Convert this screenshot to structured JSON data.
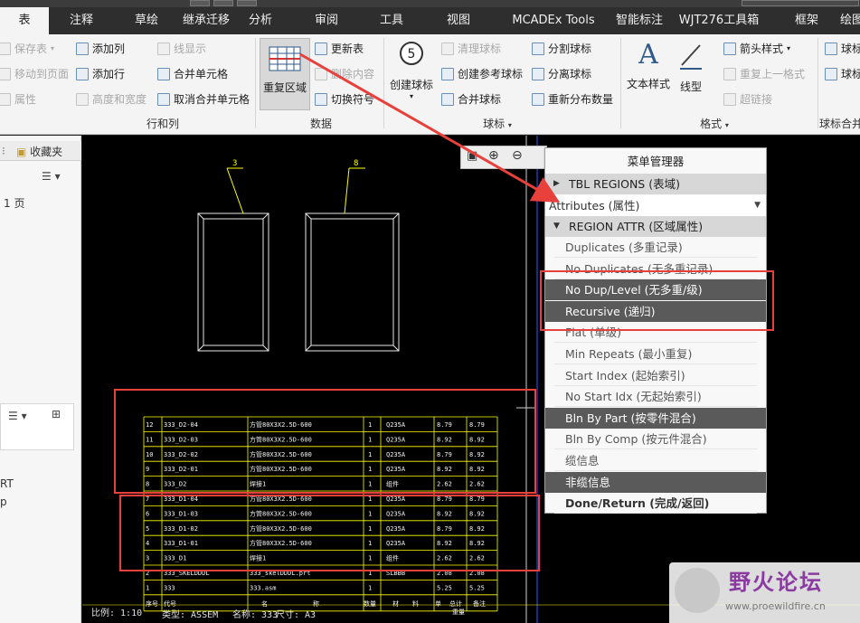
{
  "menu_tabs": [
    "表",
    "注释",
    "草绘",
    "继承迁移",
    "分析",
    "审阅",
    "工具",
    "视图",
    "MCADEx Tools",
    "智能标注",
    "WJT276工具箱",
    "框架",
    "绘图"
  ],
  "ribbon": {
    "col1": [
      "保存表",
      "移动到页面",
      "属性"
    ],
    "col2": [
      "添加列",
      "添加行",
      "高度和宽度"
    ],
    "col3": [
      "线显示",
      "合并单元格",
      "取消合并单元格"
    ],
    "group_rowcol": "行和列",
    "repeat_region": "重复区域",
    "col4": [
      "更新表",
      "删除内容",
      "切换符号"
    ],
    "group_data": "数据",
    "create_balloon": "创建球标",
    "col5": [
      "清理球标",
      "创建参考球标",
      "合并球标"
    ],
    "col6": [
      "分割球标",
      "分离球标",
      "重新分布数量"
    ],
    "group_balloon": "球标",
    "text_style": "文本样式",
    "line_type": "线型",
    "col7": [
      "箭头样式",
      "重复上一格式",
      "超链接"
    ],
    "group_format": "格式",
    "col8": [
      "球标",
      "球标"
    ],
    "group_balloon_merge": "球标合并"
  },
  "left_panel": {
    "favorites": "收藏夹",
    "page": "1 页",
    "rt": "RT",
    "p": "p"
  },
  "drawing": {
    "balloon_left": "3",
    "balloon_right": "8",
    "bom_rows": [
      [
        "12",
        "333_D2-04",
        "方管80X3X2.5D-600",
        "1",
        "Q235A",
        "8.79",
        "8.79"
      ],
      [
        "11",
        "333_D2-03",
        "方管80X3X2.5D-600",
        "1",
        "Q235A",
        "8.92",
        "8.92"
      ],
      [
        "10",
        "333_D2-02",
        "方管80X3X2.5D-600",
        "1",
        "Q235A",
        "8.79",
        "8.92"
      ],
      [
        "9",
        "333_D2-01",
        "方管80X3X2.5D-600",
        "1",
        "Q235A",
        "8.92",
        "8.92"
      ],
      [
        "8",
        "333_D2",
        "焊接1",
        "1",
        "组件",
        "2.62",
        "2.62"
      ],
      [
        "7",
        "333_D1-04",
        "方管80X3X2.5D-600",
        "1",
        "Q235A",
        "8.79",
        "8.79"
      ],
      [
        "6",
        "333_D1-03",
        "方管80X3X2.5D-600",
        "1",
        "Q235A",
        "8.92",
        "8.92"
      ],
      [
        "5",
        "333_D1-02",
        "方管80X3X2.5D-600",
        "1",
        "Q235A",
        "8.79",
        "8.92"
      ],
      [
        "4",
        "333_D1-01",
        "方管80X3X2.5D-600",
        "1",
        "Q235A",
        "8.92",
        "8.92"
      ],
      [
        "3",
        "333_D1",
        "焊接1",
        "1",
        "组件",
        "2.62",
        "2.62"
      ],
      [
        "2",
        "333_SKELDDDL",
        "333_skelDDDL.prt",
        "1",
        "SLBBB",
        "2.08",
        "2.08"
      ],
      [
        "1",
        "333",
        "333.asm",
        "1",
        "",
        "5.25",
        "5.25"
      ]
    ],
    "header_row": [
      "序号",
      "代号",
      "名",
      "称",
      "数量",
      "材",
      "料",
      "单",
      "总计",
      "备注"
    ],
    "weight_label": "重量",
    "footer_scale": "比例: 1:10",
    "footer_type": "类型: ASSEM",
    "footer_name": "名称: 333",
    "footer_size": "尺寸: A3"
  },
  "menu_manager": {
    "title": "菜单管理器",
    "head1": "TBL REGIONS (表域)",
    "select": "Attributes (属性)",
    "head2": "REGION ATTR (区域属性)",
    "items": [
      {
        "label": "Duplicates (多重记录)",
        "sel": false
      },
      {
        "label": "No Duplicates (无多重记录)",
        "sel": false
      },
      {
        "label": "No Dup/Level (无多重/级)",
        "sel": true
      },
      {
        "label": "Recursive (递归)",
        "sel": true
      },
      {
        "label": "Flat (单级)",
        "sel": false
      },
      {
        "label": "Min Repeats (最小重复)",
        "sel": false
      },
      {
        "label": "Start Index (起始索引)",
        "sel": false
      },
      {
        "label": "No Start Idx (无起始索引)",
        "sel": false
      },
      {
        "label": "Bln By Part (按零件混合)",
        "sel": true
      },
      {
        "label": "Bln By Comp (按元件混合)",
        "sel": false
      },
      {
        "label": "缆信息",
        "sel": false
      },
      {
        "label": "非缆信息",
        "sel": true
      },
      {
        "label": "Done/Return (完成/返回)",
        "sel": false
      }
    ]
  },
  "watermark": {
    "title": "野火论坛",
    "url": "www.proewildfire.cn"
  },
  "colors": {
    "annotation_red": "#e8403a",
    "cad_yellow": "#ffff00",
    "selected_item": "#5a5a5a"
  }
}
